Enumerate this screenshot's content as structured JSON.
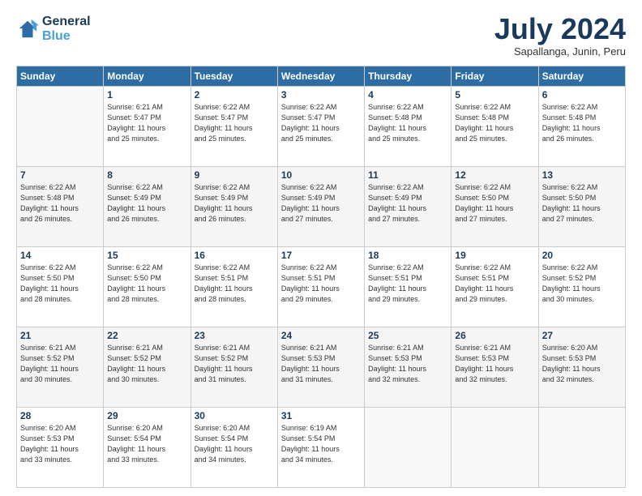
{
  "logo": {
    "line1": "General",
    "line2": "Blue"
  },
  "title": "July 2024",
  "subtitle": "Sapallanga, Junin, Peru",
  "weekdays": [
    "Sunday",
    "Monday",
    "Tuesday",
    "Wednesday",
    "Thursday",
    "Friday",
    "Saturday"
  ],
  "weeks": [
    [
      {
        "day": "",
        "info": ""
      },
      {
        "day": "1",
        "info": "Sunrise: 6:21 AM\nSunset: 5:47 PM\nDaylight: 11 hours\nand 25 minutes."
      },
      {
        "day": "2",
        "info": "Sunrise: 6:22 AM\nSunset: 5:47 PM\nDaylight: 11 hours\nand 25 minutes."
      },
      {
        "day": "3",
        "info": "Sunrise: 6:22 AM\nSunset: 5:47 PM\nDaylight: 11 hours\nand 25 minutes."
      },
      {
        "day": "4",
        "info": "Sunrise: 6:22 AM\nSunset: 5:48 PM\nDaylight: 11 hours\nand 25 minutes."
      },
      {
        "day": "5",
        "info": "Sunrise: 6:22 AM\nSunset: 5:48 PM\nDaylight: 11 hours\nand 25 minutes."
      },
      {
        "day": "6",
        "info": "Sunrise: 6:22 AM\nSunset: 5:48 PM\nDaylight: 11 hours\nand 26 minutes."
      }
    ],
    [
      {
        "day": "7",
        "info": "Sunrise: 6:22 AM\nSunset: 5:48 PM\nDaylight: 11 hours\nand 26 minutes."
      },
      {
        "day": "8",
        "info": "Sunrise: 6:22 AM\nSunset: 5:49 PM\nDaylight: 11 hours\nand 26 minutes."
      },
      {
        "day": "9",
        "info": "Sunrise: 6:22 AM\nSunset: 5:49 PM\nDaylight: 11 hours\nand 26 minutes."
      },
      {
        "day": "10",
        "info": "Sunrise: 6:22 AM\nSunset: 5:49 PM\nDaylight: 11 hours\nand 27 minutes."
      },
      {
        "day": "11",
        "info": "Sunrise: 6:22 AM\nSunset: 5:49 PM\nDaylight: 11 hours\nand 27 minutes."
      },
      {
        "day": "12",
        "info": "Sunrise: 6:22 AM\nSunset: 5:50 PM\nDaylight: 11 hours\nand 27 minutes."
      },
      {
        "day": "13",
        "info": "Sunrise: 6:22 AM\nSunset: 5:50 PM\nDaylight: 11 hours\nand 27 minutes."
      }
    ],
    [
      {
        "day": "14",
        "info": "Sunrise: 6:22 AM\nSunset: 5:50 PM\nDaylight: 11 hours\nand 28 minutes."
      },
      {
        "day": "15",
        "info": "Sunrise: 6:22 AM\nSunset: 5:50 PM\nDaylight: 11 hours\nand 28 minutes."
      },
      {
        "day": "16",
        "info": "Sunrise: 6:22 AM\nSunset: 5:51 PM\nDaylight: 11 hours\nand 28 minutes."
      },
      {
        "day": "17",
        "info": "Sunrise: 6:22 AM\nSunset: 5:51 PM\nDaylight: 11 hours\nand 29 minutes."
      },
      {
        "day": "18",
        "info": "Sunrise: 6:22 AM\nSunset: 5:51 PM\nDaylight: 11 hours\nand 29 minutes."
      },
      {
        "day": "19",
        "info": "Sunrise: 6:22 AM\nSunset: 5:51 PM\nDaylight: 11 hours\nand 29 minutes."
      },
      {
        "day": "20",
        "info": "Sunrise: 6:22 AM\nSunset: 5:52 PM\nDaylight: 11 hours\nand 30 minutes."
      }
    ],
    [
      {
        "day": "21",
        "info": "Sunrise: 6:21 AM\nSunset: 5:52 PM\nDaylight: 11 hours\nand 30 minutes."
      },
      {
        "day": "22",
        "info": "Sunrise: 6:21 AM\nSunset: 5:52 PM\nDaylight: 11 hours\nand 30 minutes."
      },
      {
        "day": "23",
        "info": "Sunrise: 6:21 AM\nSunset: 5:52 PM\nDaylight: 11 hours\nand 31 minutes."
      },
      {
        "day": "24",
        "info": "Sunrise: 6:21 AM\nSunset: 5:53 PM\nDaylight: 11 hours\nand 31 minutes."
      },
      {
        "day": "25",
        "info": "Sunrise: 6:21 AM\nSunset: 5:53 PM\nDaylight: 11 hours\nand 32 minutes."
      },
      {
        "day": "26",
        "info": "Sunrise: 6:21 AM\nSunset: 5:53 PM\nDaylight: 11 hours\nand 32 minutes."
      },
      {
        "day": "27",
        "info": "Sunrise: 6:20 AM\nSunset: 5:53 PM\nDaylight: 11 hours\nand 32 minutes."
      }
    ],
    [
      {
        "day": "28",
        "info": "Sunrise: 6:20 AM\nSunset: 5:53 PM\nDaylight: 11 hours\nand 33 minutes."
      },
      {
        "day": "29",
        "info": "Sunrise: 6:20 AM\nSunset: 5:54 PM\nDaylight: 11 hours\nand 33 minutes."
      },
      {
        "day": "30",
        "info": "Sunrise: 6:20 AM\nSunset: 5:54 PM\nDaylight: 11 hours\nand 34 minutes."
      },
      {
        "day": "31",
        "info": "Sunrise: 6:19 AM\nSunset: 5:54 PM\nDaylight: 11 hours\nand 34 minutes."
      },
      {
        "day": "",
        "info": ""
      },
      {
        "day": "",
        "info": ""
      },
      {
        "day": "",
        "info": ""
      }
    ]
  ]
}
